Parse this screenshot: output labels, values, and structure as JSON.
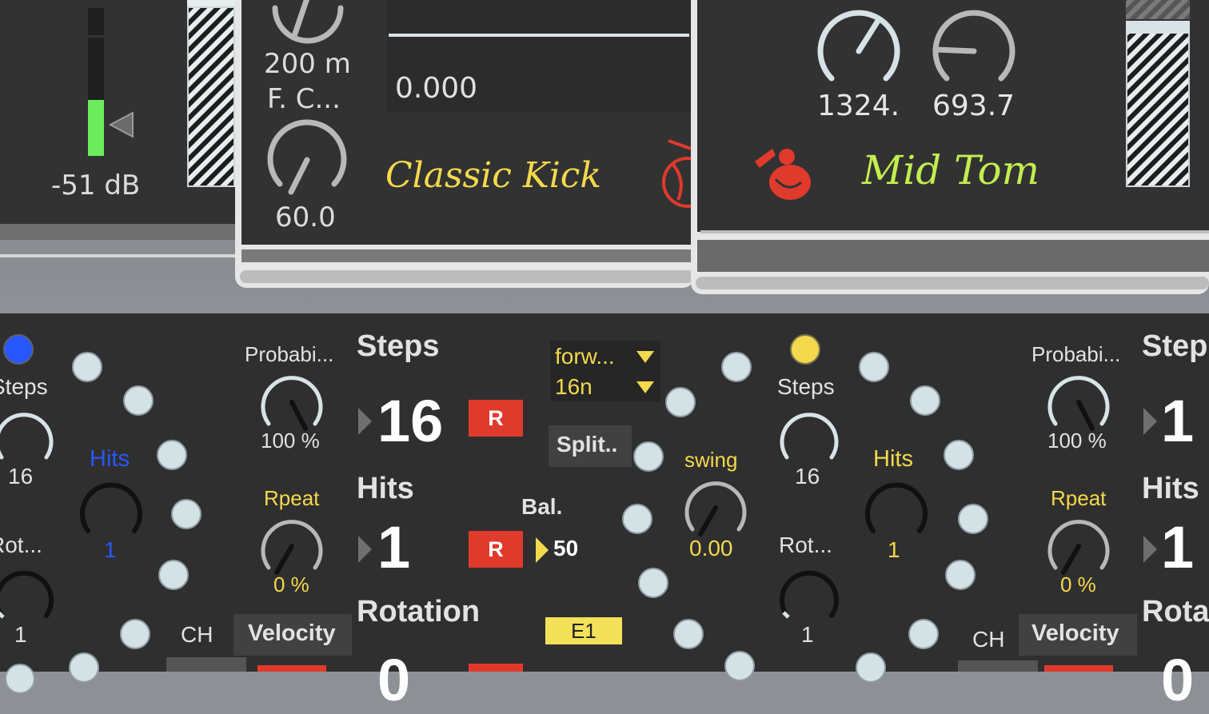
{
  "colors": {
    "panel": "#323232",
    "accent_yellow": "#f4d94c",
    "accent_green": "#c2ee4f",
    "accent_blue": "#2957ff",
    "meter_green": "#6bec5d",
    "record_red": "#e03a2c",
    "step_dot": "#d4e1e5"
  },
  "meter": {
    "value_label": "-51 dB",
    "level": 0.3
  },
  "classic_kick": {
    "name": "Classic Kick",
    "knob_top_value": "200 m",
    "knob_label": "F. C...",
    "knob_bottom_value": "60.0",
    "envelope_value": "0.000",
    "icon": "monkey-trumpet-icon"
  },
  "mid_tom": {
    "name": "Mid Tom",
    "knob1_value": "1324.",
    "knob2_value": "693.7",
    "icon": "monkey-trumpet-icon"
  },
  "seq_left": {
    "indicator_color": "#2957ff",
    "steps_label": "Steps",
    "steps_knob_value": "16",
    "hits_label": "Hits",
    "hits_knob_value": "1",
    "rot_label": "Rot...",
    "rot_value": "1",
    "prob_label": "Probabi...",
    "prob_value": "100 %",
    "repeat_label": "Rpeat",
    "repeat_value": "0 %",
    "ch_label": "CH",
    "velocity_label": "Velocity"
  },
  "seq_center": {
    "steps_label": "Steps",
    "steps_value": "16",
    "hits_label": "Hits",
    "hits_value": "1",
    "rotation_label": "Rotation",
    "rotation_value": "0",
    "r_label": "R",
    "direction": "forw...",
    "rate": "16n",
    "split_label": "Split..",
    "bal_label": "Bal.",
    "bal_value": "50",
    "note_label": "E1",
    "swing_label": "swing",
    "swing_value": "0.00"
  },
  "seq_right": {
    "indicator_color": "#f4d94c",
    "steps_label": "Steps",
    "steps_knob_value": "16",
    "hits_label": "Hits",
    "hits_knob_value": "1",
    "rot_label": "Rot...",
    "rot_value": "1",
    "prob_label": "Probabi...",
    "prob_value": "100 %",
    "repeat_label": "Rpeat",
    "repeat_value": "0 %",
    "ch_label": "CH",
    "velocity_label": "Velocity",
    "steps_big_label": "Step",
    "steps_big_value": "1",
    "hits_big_label": "Hits",
    "hits_big_value": "1",
    "rotation_big_label": "Rota",
    "rotation_big_value": "0"
  }
}
